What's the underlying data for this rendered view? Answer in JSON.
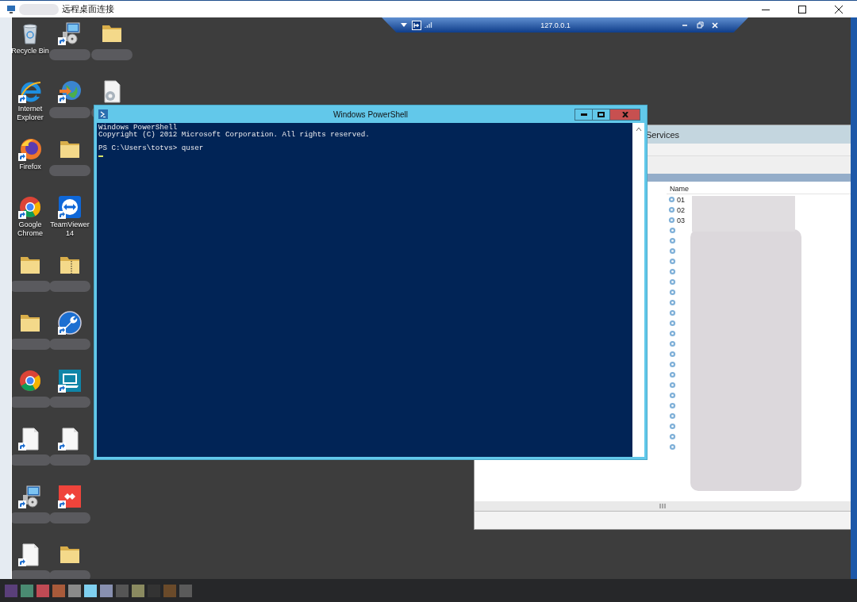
{
  "window": {
    "title": "远程桌面连接"
  },
  "connection_bar": {
    "host": "127.0.0.1"
  },
  "desktop_icons": [
    [
      {
        "kind": "recycle-bin",
        "label": "Recycle Bin",
        "shortcut": false
      },
      {
        "kind": "installer",
        "shortcut": true
      },
      {
        "kind": "folder",
        "shortcut": false
      }
    ],
    [
      {
        "kind": "ie",
        "label": "Internet Explorer",
        "shortcut": true
      },
      {
        "kind": "globe",
        "shortcut": true
      },
      {
        "kind": "document-gear",
        "shortcut": false
      }
    ],
    [
      {
        "kind": "firefox",
        "label": "Firefox",
        "shortcut": true
      },
      {
        "kind": "folder",
        "shortcut": false
      }
    ],
    [
      {
        "kind": "chrome",
        "label": "Google Chrome",
        "shortcut": true
      },
      {
        "kind": "teamviewer",
        "label": "TeamViewer 14",
        "shortcut": true
      }
    ],
    [
      {
        "kind": "folder",
        "shortcut": false
      },
      {
        "kind": "zip-folder",
        "shortcut": false
      }
    ],
    [
      {
        "kind": "folder",
        "shortcut": false
      },
      {
        "kind": "dev-tool",
        "shortcut": true
      }
    ],
    [
      {
        "kind": "chrome",
        "shortcut": false
      },
      {
        "kind": "laptop",
        "shortcut": true
      }
    ],
    [
      {
        "kind": "document",
        "shortcut": true
      },
      {
        "kind": "document",
        "shortcut": true
      }
    ],
    [
      {
        "kind": "installer",
        "shortcut": true
      },
      {
        "kind": "remote-app",
        "shortcut": true
      }
    ],
    [
      {
        "kind": "document",
        "shortcut": true
      },
      {
        "kind": "folder",
        "shortcut": false
      }
    ]
  ],
  "services": {
    "title": "Services",
    "columns": [
      "Name"
    ],
    "rows": [
      "01",
      "02",
      "03"
    ]
  },
  "powershell": {
    "title": "Windows PowerShell",
    "blocks": [
      [
        "Windows PowerShell",
        "Copyright (C) 2012 Microsoft Corporation. All rights reserved."
      ],
      [
        "PS C:\\Users\\totvs> quser"
      ]
    ]
  }
}
